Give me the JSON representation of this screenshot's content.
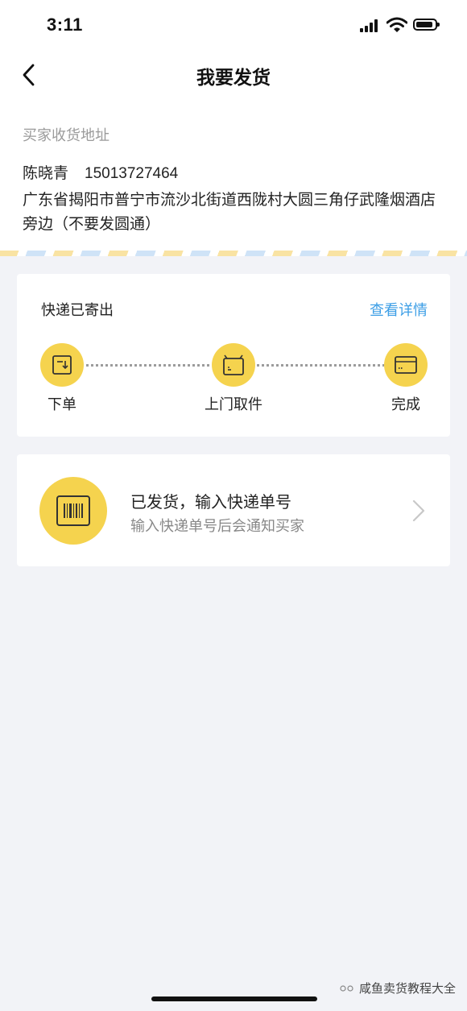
{
  "status_bar": {
    "time": "3:11"
  },
  "nav": {
    "title": "我要发货"
  },
  "address": {
    "label": "买家收货地址",
    "name": "陈晓青",
    "phone": "15013727464",
    "detail": "广东省揭阳市普宁市流沙北街道西陇村大圆三角仔武隆烟酒店旁边（不要发圆通）"
  },
  "tracking": {
    "title": "快递已寄出",
    "link": "查看详情",
    "steps": [
      {
        "label": "下单",
        "icon": "order-icon"
      },
      {
        "label": "上门取件",
        "icon": "pickup-box-icon"
      },
      {
        "label": "完成",
        "icon": "card-icon"
      }
    ]
  },
  "ship": {
    "title": "已发货，输入快递单号",
    "subtitle": "输入快递单号后会通知买家",
    "icon": "barcode-icon"
  },
  "watermark": {
    "text": "咸鱼卖货教程大全"
  },
  "colors": {
    "accent_yellow": "#f5d34e",
    "link_blue": "#3c9ee6",
    "background": "#f2f3f7"
  }
}
